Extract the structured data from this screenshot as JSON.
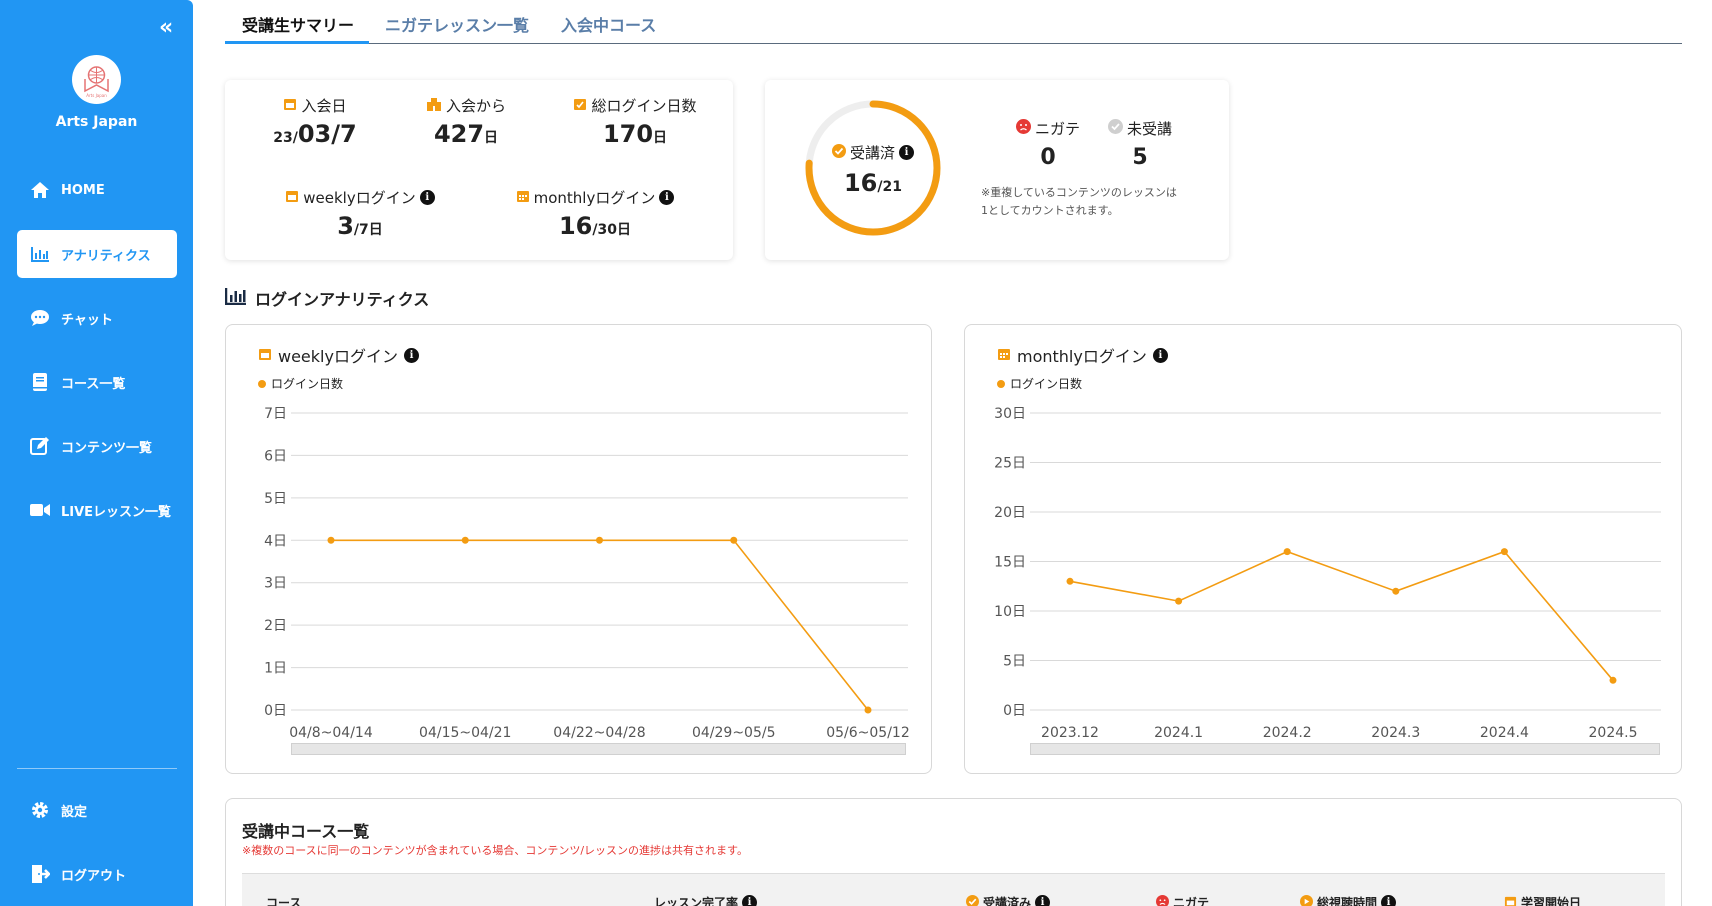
{
  "sidebar": {
    "org_name": "Arts Japan",
    "logo_text": "Arts Japan",
    "collapse_icon": "double-chevron-left-icon",
    "items": [
      {
        "label": "HOME",
        "icon": "home-icon"
      },
      {
        "label": "アナリティクス",
        "icon": "bar-chart-icon",
        "active": true
      },
      {
        "label": "チャット",
        "icon": "chat-bubble-icon"
      },
      {
        "label": "コース一覧",
        "icon": "book-icon"
      },
      {
        "label": "コンテンツ一覧",
        "icon": "edit-icon"
      },
      {
        "label": "LIVEレッスン一覧",
        "icon": "video-camera-icon"
      }
    ],
    "bottom_items": [
      {
        "label": "設定",
        "icon": "gear-icon"
      },
      {
        "label": "ログアウト",
        "icon": "logout-icon"
      }
    ]
  },
  "tabs": [
    "受講生サマリー",
    "ニガテレッスン一覧",
    "入会中コース"
  ],
  "summary": {
    "join_date": {
      "label": "入会日",
      "prefix": "23/",
      "value": "03/7"
    },
    "since_join": {
      "label": "入会から",
      "value": "427",
      "unit": "日"
    },
    "total_login": {
      "label": "総ログイン日数",
      "value": "170",
      "unit": "日"
    },
    "weekly_login": {
      "label": "weeklyログイン",
      "value": "3",
      "unit": "/7日"
    },
    "monthly_login": {
      "label": "monthlyログイン",
      "value": "16",
      "unit": "/30日"
    }
  },
  "progress": {
    "label": "受講済",
    "done": "16",
    "total": "/21",
    "fraction": 0.7619,
    "weak_label": "ニガテ",
    "weak_value": "0",
    "untaken_label": "未受講",
    "untaken_value": "5",
    "note_line1": "※重複しているコンテンツのレッスンは",
    "note_line2": "1としてカウントされます。"
  },
  "section_title": "ログインアナリティクス",
  "chart_data": [
    {
      "type": "line",
      "title": "weeklyログイン",
      "series": [
        {
          "name": "ログイン日数",
          "values": [
            4,
            4,
            4,
            4,
            0
          ]
        }
      ],
      "categories": [
        "04/8~04/14",
        "04/15~04/21",
        "04/22~04/28",
        "04/29~05/5",
        "05/6~05/12"
      ],
      "yticks": [
        "0日",
        "1日",
        "2日",
        "3日",
        "4日",
        "5日",
        "6日",
        "7日"
      ],
      "ylim": [
        0,
        7
      ],
      "color": "#f39c12",
      "grid": true,
      "legend": "top-left"
    },
    {
      "type": "line",
      "title": "monthlyログイン",
      "series": [
        {
          "name": "ログイン日数",
          "values": [
            13,
            11,
            16,
            12,
            16,
            3
          ]
        }
      ],
      "categories": [
        "2023.12",
        "2024.1",
        "2024.2",
        "2024.3",
        "2024.4",
        "2024.5"
      ],
      "yticks": [
        "0日",
        "5日",
        "10日",
        "15日",
        "20日",
        "25日",
        "30日"
      ],
      "ylim": [
        0,
        30
      ],
      "color": "#f39c12",
      "grid": true,
      "legend": "top-left"
    }
  ],
  "courses": {
    "title": "受講中コース一覧",
    "note": "※複数のコースに同一のコンテンツが含まれている場合、コンテンツ/レッスンの進捗は共有されます。",
    "columns": [
      "コース",
      "レッスン完了率",
      "受講済み",
      "ニガテ",
      "総視聴時間",
      "学習開始日"
    ]
  },
  "colors": {
    "primary": "#2196f3",
    "accent": "#f39c12",
    "danger": "#e53935"
  }
}
